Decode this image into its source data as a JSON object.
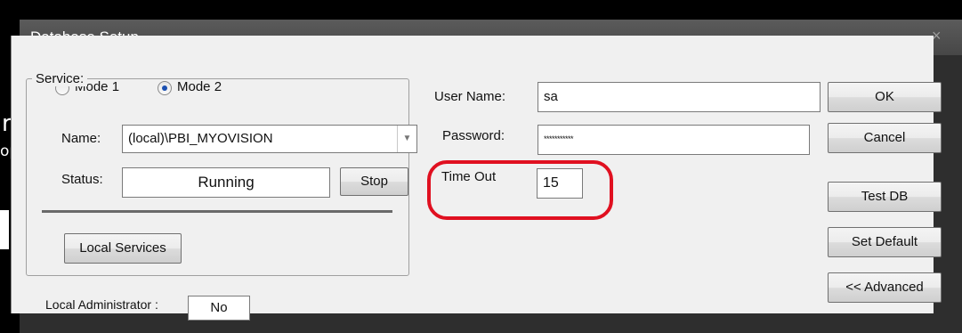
{
  "background": {
    "fragment_r": "r",
    "fragment_op": "op"
  },
  "window": {
    "title": "Database Setup",
    "close_glyph": "×"
  },
  "mode": {
    "option1": "Mode 1",
    "option2": "Mode 2",
    "selected": "Mode 2"
  },
  "service": {
    "group_label": "Service:",
    "name_label": "Name:",
    "name_value": "(local)\\PBI_MYOVISION",
    "status_label": "Status:",
    "status_value": "Running",
    "stop_button": "Stop",
    "local_services_button": "Local Services"
  },
  "admin": {
    "label": "Local Administrator :",
    "value": "No"
  },
  "credentials": {
    "username_label": "User Name:",
    "username_value": "sa",
    "password_label": "Password:",
    "password_value": "***********",
    "timeout_label": "Time Out",
    "timeout_value": "15"
  },
  "buttons": {
    "ok": "OK",
    "cancel": "Cancel",
    "test_db": "Test DB",
    "set_default": "Set Default",
    "advanced": "<< Advanced"
  },
  "colors": {
    "annotation": "#e01020",
    "titlebar": "#4f4f4f",
    "dialog_bg": "#f0f0f0"
  },
  "icons": {
    "combo_arrow": "chevron-down-icon",
    "close": "close-icon"
  }
}
